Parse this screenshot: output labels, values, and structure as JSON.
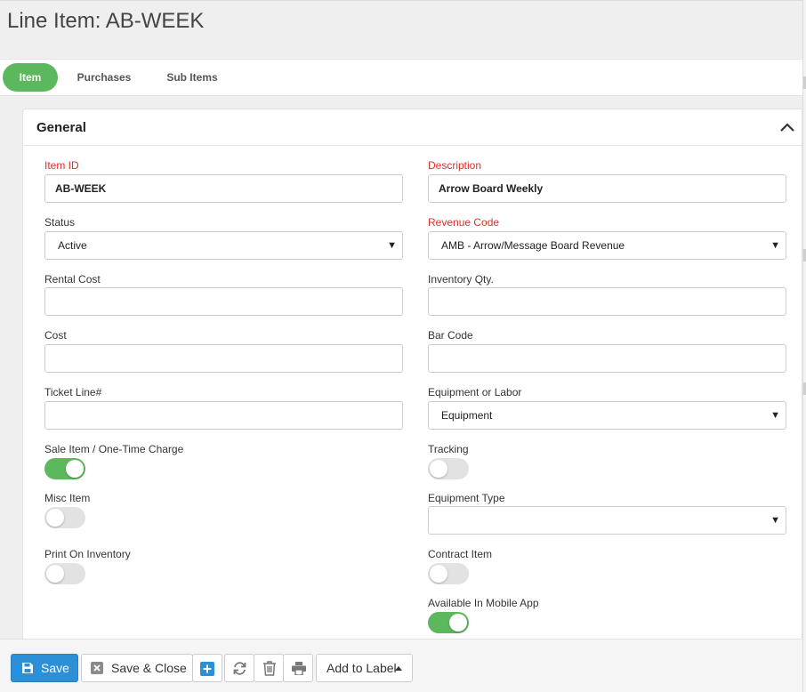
{
  "header": {
    "title": "Line Item: AB-WEEK"
  },
  "tabs": [
    {
      "label": "Item",
      "active": true
    },
    {
      "label": "Purchases",
      "active": false
    },
    {
      "label": "Sub Items",
      "active": false
    }
  ],
  "section": {
    "title": "General",
    "icon": "chevron-up-icon"
  },
  "fields": {
    "item_id": {
      "label": "Item ID",
      "value": "AB-WEEK",
      "required": true
    },
    "description": {
      "label": "Description",
      "value": "Arrow Board Weekly",
      "required": true
    },
    "status": {
      "label": "Status",
      "value": "Active"
    },
    "revenue_code": {
      "label": "Revenue Code",
      "value": "AMB - Arrow/Message Board Revenue",
      "required": true
    },
    "rental_cost": {
      "label": "Rental Cost",
      "value": ""
    },
    "inventory_qty": {
      "label": "Inventory Qty.",
      "value": ""
    },
    "cost": {
      "label": "Cost",
      "value": ""
    },
    "bar_code": {
      "label": "Bar Code",
      "value": ""
    },
    "ticket_line": {
      "label": "Ticket Line#",
      "value": ""
    },
    "equipment_or_labor": {
      "label": "Equipment or Labor",
      "value": "Equipment"
    },
    "sale_item": {
      "label": "Sale Item / One-Time Charge",
      "on": true
    },
    "tracking": {
      "label": "Tracking",
      "on": false
    },
    "misc_item": {
      "label": "Misc Item",
      "on": false
    },
    "equipment_type": {
      "label": "Equipment Type",
      "value": ""
    },
    "print_on_inventory": {
      "label": "Print On Inventory",
      "on": false
    },
    "contract_item": {
      "label": "Contract Item",
      "on": false
    },
    "available_in_mobile_app": {
      "label": "Available In Mobile App",
      "on": true
    }
  },
  "toolbar": {
    "save_label": "Save",
    "save_close_label": "Save & Close",
    "add_to_label_label": "Add to Label",
    "icons": [
      "save-icon",
      "close-box-icon",
      "plus-icon",
      "refresh-icon",
      "trash-icon",
      "print-icon",
      "caret-up-icon"
    ]
  },
  "colors": {
    "accent_green": "#5cb85c",
    "save_blue": "#2d8fd5",
    "required_red": "#d9312b"
  }
}
